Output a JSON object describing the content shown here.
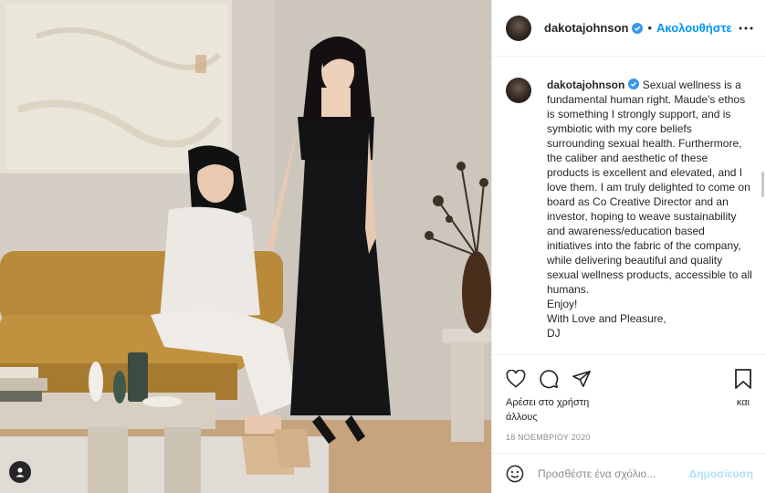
{
  "post": {
    "username": "dakotajohnson",
    "follow_label": "Ακολουθήστε",
    "dot": "•",
    "caption": "Sexual wellness is a fundamental human right. Maude's ethos is something I strongly support, and is symbiotic with my core beliefs surrounding sexual health. Furthermore, the caliber and aesthetic of these products is excellent and elevated, and I love them. I am truly delighted to come on board as Co Creative Director and an investor, hoping to weave sustainability and awareness/education based initiatives into the fabric of the company, while delivering beautiful and quality sexual wellness products, accessible to all humans.\nEnjoy!\nWith Love and Pleasure,\nDJ",
    "likes_prefix": "Αρέσει στο χρήστη",
    "likes_and": "και",
    "likes_others": "άλλους",
    "date": "18 ΝΟΕΜΒΡΙΟΥ 2020",
    "comment_placeholder": "Προσθέστε ένα σχόλιο...",
    "post_label": "Δημοσίευση"
  },
  "icons": {
    "header_more": "more-horizontal-icon",
    "verified": "verified-badge-icon",
    "like": "heart-icon",
    "comment": "comment-icon",
    "share": "send-icon",
    "save": "bookmark-icon",
    "emoji": "emoji-icon",
    "user_tag": "user-tag-icon"
  },
  "colors": {
    "link_blue": "#0095f6",
    "verified_blue": "#3897f0",
    "muted": "#8e8e8e",
    "post_disabled": "#b2dffc"
  }
}
